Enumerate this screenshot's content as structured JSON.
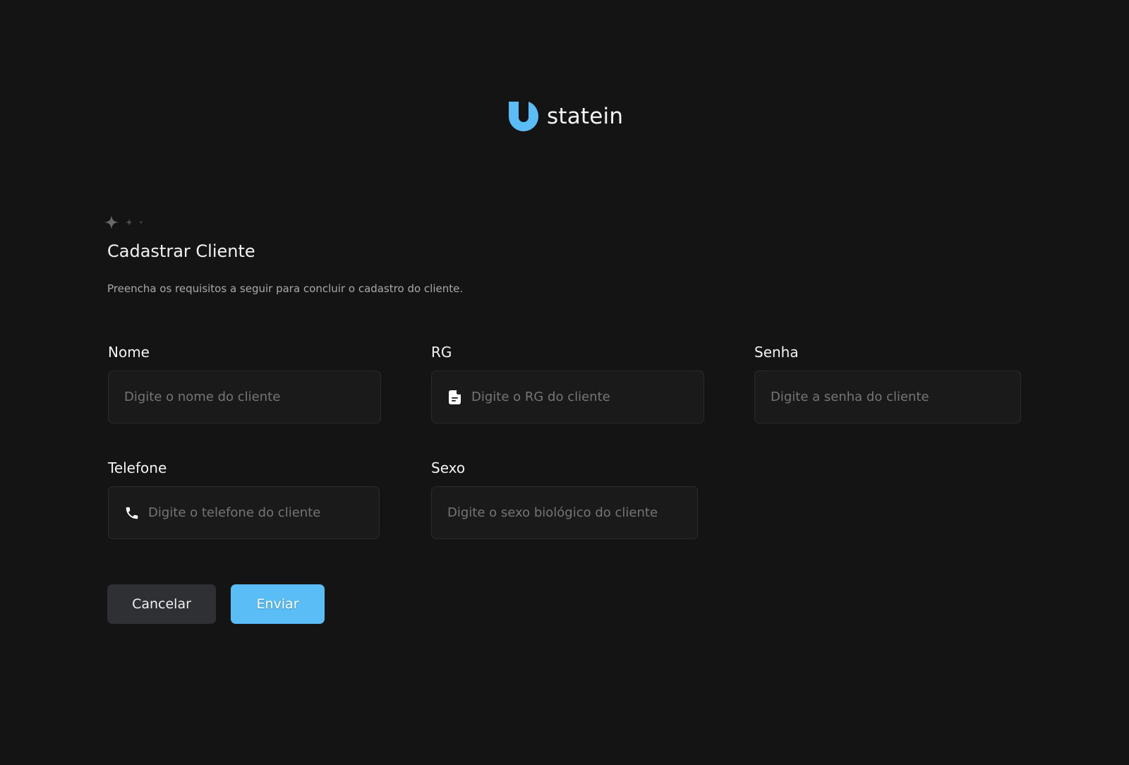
{
  "brand": {
    "name": "statein",
    "accent_color": "#5bbdf5"
  },
  "form": {
    "title": "Cadastrar Cliente",
    "subtitle": "Preencha os requisitos a seguir para concluir o cadastro do cliente.",
    "fields": {
      "nome": {
        "label": "Nome",
        "placeholder": "Digite o nome do cliente",
        "value": ""
      },
      "rg": {
        "label": "RG",
        "placeholder": "Digite o RG do cliente",
        "value": "",
        "icon": "document-icon"
      },
      "senha": {
        "label": "Senha",
        "placeholder": "Digite a senha do cliente",
        "value": ""
      },
      "telefone": {
        "label": "Telefone",
        "placeholder": "Digite o telefone do cliente",
        "value": "",
        "icon": "phone-icon"
      },
      "sexo": {
        "label": "Sexo",
        "placeholder": "Digite o sexo biológico do cliente",
        "value": ""
      }
    },
    "buttons": {
      "cancel_label": "Cancelar",
      "submit_label": "Enviar"
    }
  }
}
